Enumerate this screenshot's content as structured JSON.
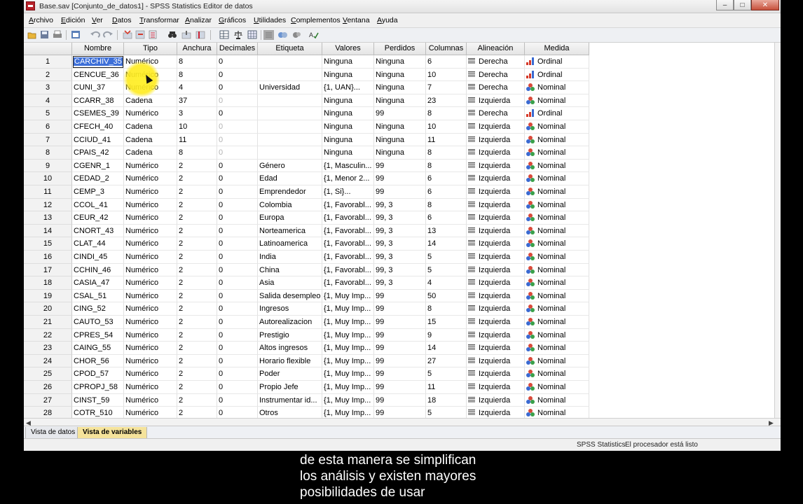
{
  "window": {
    "title": "Base.sav [Conjunto_de_datos1] - SPSS Statistics Editor de datos",
    "minimize": "–",
    "maximize": "□",
    "close": "✕"
  },
  "menu": [
    "Archivo",
    "Edición",
    "Ver",
    "Datos",
    "Transformar",
    "Analizar",
    "Gráficos",
    "Utilidades",
    "Complementos",
    "Ventana",
    "Ayuda"
  ],
  "toolbar_icons": [
    "open-icon",
    "save-icon",
    "print-icon",
    "dialog-recall-icon",
    "undo-icon",
    "redo-icon",
    "goto-case-icon",
    "goto-variable-icon",
    "variables-icon",
    "find-icon",
    "insert-cases-icon",
    "insert-variable-icon",
    "split-file-icon",
    "weight-cases-icon",
    "select-cases-icon",
    "value-labels-icon",
    "use-sets-icon",
    "show-all-icon",
    "spell-icon"
  ],
  "columns": [
    "Nombre",
    "Tipo",
    "Anchura",
    "Decimales",
    "Etiqueta",
    "Valores",
    "Perdidos",
    "Columnas",
    "Alineación",
    "Medida"
  ],
  "rows": [
    {
      "n": "1",
      "nombre": "CARCHIV_35",
      "tipo": "Numérico",
      "anchura": "8",
      "dec": "0",
      "dec_gray": false,
      "etiqueta": "",
      "valores": "Ninguna",
      "perdidos": "Ninguna",
      "columnas": "6",
      "alineacion": "Derecha",
      "medida": "Ordinal"
    },
    {
      "n": "2",
      "nombre": "CENCUE_36",
      "tipo": "Numérico",
      "anchura": "8",
      "dec": "0",
      "dec_gray": false,
      "etiqueta": "",
      "valores": "Ninguna",
      "perdidos": "Ninguna",
      "columnas": "10",
      "alineacion": "Derecha",
      "medida": "Ordinal"
    },
    {
      "n": "3",
      "nombre": "CUNI_37",
      "tipo": "Numérico",
      "anchura": "4",
      "dec": "0",
      "dec_gray": false,
      "etiqueta": "Universidad",
      "valores": "{1, UAN}...",
      "perdidos": "Ninguna",
      "columnas": "7",
      "alineacion": "Derecha",
      "medida": "Nominal"
    },
    {
      "n": "4",
      "nombre": "CCARR_38",
      "tipo": "Cadena",
      "anchura": "37",
      "dec": "0",
      "dec_gray": true,
      "etiqueta": "",
      "valores": "Ninguna",
      "perdidos": "Ninguna",
      "columnas": "23",
      "alineacion": "Izquierda",
      "medida": "Nominal"
    },
    {
      "n": "5",
      "nombre": "CSEMES_39",
      "tipo": "Numérico",
      "anchura": "3",
      "dec": "0",
      "dec_gray": false,
      "etiqueta": "",
      "valores": "Ninguna",
      "perdidos": "99",
      "columnas": "8",
      "alineacion": "Derecha",
      "medida": "Ordinal"
    },
    {
      "n": "6",
      "nombre": "CFECH_40",
      "tipo": "Cadena",
      "anchura": "10",
      "dec": "0",
      "dec_gray": true,
      "etiqueta": "",
      "valores": "Ninguna",
      "perdidos": "Ninguna",
      "columnas": "10",
      "alineacion": "Izquierda",
      "medida": "Nominal"
    },
    {
      "n": "7",
      "nombre": "CCIUD_41",
      "tipo": "Cadena",
      "anchura": "11",
      "dec": "0",
      "dec_gray": true,
      "etiqueta": "",
      "valores": "Ninguna",
      "perdidos": "Ninguna",
      "columnas": "11",
      "alineacion": "Izquierda",
      "medida": "Nominal"
    },
    {
      "n": "8",
      "nombre": "CPAIS_42",
      "tipo": "Cadena",
      "anchura": "8",
      "dec": "0",
      "dec_gray": true,
      "etiqueta": "",
      "valores": "Ninguna",
      "perdidos": "Ninguna",
      "columnas": "8",
      "alineacion": "Izquierda",
      "medida": "Nominal"
    },
    {
      "n": "9",
      "nombre": "CGENR_1",
      "tipo": "Numérico",
      "anchura": "2",
      "dec": "0",
      "dec_gray": false,
      "etiqueta": "Género",
      "valores": "{1, Masculin...",
      "perdidos": "99",
      "columnas": "8",
      "alineacion": "Izquierda",
      "medida": "Nominal"
    },
    {
      "n": "10",
      "nombre": "CEDAD_2",
      "tipo": "Numérico",
      "anchura": "2",
      "dec": "0",
      "dec_gray": false,
      "etiqueta": "Edad",
      "valores": "{1, Menor 2...",
      "perdidos": "99",
      "columnas": "6",
      "alineacion": "Izquierda",
      "medida": "Nominal"
    },
    {
      "n": "11",
      "nombre": "CEMP_3",
      "tipo": "Numérico",
      "anchura": "2",
      "dec": "0",
      "dec_gray": false,
      "etiqueta": "Emprendedor",
      "valores": "{1, Si}...",
      "perdidos": "99",
      "columnas": "6",
      "alineacion": "Izquierda",
      "medida": "Nominal"
    },
    {
      "n": "12",
      "nombre": "CCOL_41",
      "tipo": "Numérico",
      "anchura": "2",
      "dec": "0",
      "dec_gray": false,
      "etiqueta": "Colombia",
      "valores": "{1, Favorabl...",
      "perdidos": "99, 3",
      "columnas": "8",
      "alineacion": "Izquierda",
      "medida": "Nominal"
    },
    {
      "n": "13",
      "nombre": "CEUR_42",
      "tipo": "Numérico",
      "anchura": "2",
      "dec": "0",
      "dec_gray": false,
      "etiqueta": "Europa",
      "valores": "{1, Favorabl...",
      "perdidos": "99, 3",
      "columnas": "6",
      "alineacion": "Izquierda",
      "medida": "Nominal"
    },
    {
      "n": "14",
      "nombre": "CNORT_43",
      "tipo": "Numérico",
      "anchura": "2",
      "dec": "0",
      "dec_gray": false,
      "etiqueta": "Norteamerica",
      "valores": "{1, Favorabl...",
      "perdidos": "99, 3",
      "columnas": "13",
      "alineacion": "Izquierda",
      "medida": "Nominal"
    },
    {
      "n": "15",
      "nombre": "CLAT_44",
      "tipo": "Numérico",
      "anchura": "2",
      "dec": "0",
      "dec_gray": false,
      "etiqueta": "Latinoamerica",
      "valores": "{1, Favorabl...",
      "perdidos": "99, 3",
      "columnas": "14",
      "alineacion": "Izquierda",
      "medida": "Nominal"
    },
    {
      "n": "16",
      "nombre": "CINDI_45",
      "tipo": "Numérico",
      "anchura": "2",
      "dec": "0",
      "dec_gray": false,
      "etiqueta": "India",
      "valores": "{1, Favorabl...",
      "perdidos": "99, 3",
      "columnas": "5",
      "alineacion": "Izquierda",
      "medida": "Nominal"
    },
    {
      "n": "17",
      "nombre": "CCHIN_46",
      "tipo": "Numérico",
      "anchura": "2",
      "dec": "0",
      "dec_gray": false,
      "etiqueta": "China",
      "valores": "{1, Favorabl...",
      "perdidos": "99, 3",
      "columnas": "5",
      "alineacion": "Izquierda",
      "medida": "Nominal"
    },
    {
      "n": "18",
      "nombre": "CASIA_47",
      "tipo": "Numérico",
      "anchura": "2",
      "dec": "0",
      "dec_gray": false,
      "etiqueta": "Asia",
      "valores": "{1, Favorabl...",
      "perdidos": "99, 3",
      "columnas": "4",
      "alineacion": "Izquierda",
      "medida": "Nominal"
    },
    {
      "n": "19",
      "nombre": "CSAL_51",
      "tipo": "Numérico",
      "anchura": "2",
      "dec": "0",
      "dec_gray": false,
      "etiqueta": "Salida desempleo",
      "valores": "{1, Muy Imp...",
      "perdidos": "99",
      "columnas": "50",
      "alineacion": "Izquierda",
      "medida": "Nominal"
    },
    {
      "n": "20",
      "nombre": "CING_52",
      "tipo": "Numérico",
      "anchura": "2",
      "dec": "0",
      "dec_gray": false,
      "etiqueta": "Ingresos",
      "valores": "{1, Muy Imp...",
      "perdidos": "99",
      "columnas": "8",
      "alineacion": "Izquierda",
      "medida": "Nominal"
    },
    {
      "n": "21",
      "nombre": "CAUTO_53",
      "tipo": "Numérico",
      "anchura": "2",
      "dec": "0",
      "dec_gray": false,
      "etiqueta": "Autorealizacion",
      "valores": "{1, Muy Imp...",
      "perdidos": "99",
      "columnas": "15",
      "alineacion": "Izquierda",
      "medida": "Nominal"
    },
    {
      "n": "22",
      "nombre": "CPRES_54",
      "tipo": "Numérico",
      "anchura": "2",
      "dec": "0",
      "dec_gray": false,
      "etiqueta": "Prestigio",
      "valores": "{1, Muy Imp...",
      "perdidos": "99",
      "columnas": "9",
      "alineacion": "Izquierda",
      "medida": "Nominal"
    },
    {
      "n": "23",
      "nombre": "CAING_55",
      "tipo": "Numérico",
      "anchura": "2",
      "dec": "0",
      "dec_gray": false,
      "etiqueta": "Altos ingresos",
      "valores": "{1, Muy Imp...",
      "perdidos": "99",
      "columnas": "14",
      "alineacion": "Izquierda",
      "medida": "Nominal"
    },
    {
      "n": "24",
      "nombre": "CHOR_56",
      "tipo": "Numérico",
      "anchura": "2",
      "dec": "0",
      "dec_gray": false,
      "etiqueta": "Horario flexible",
      "valores": "{1, Muy Imp...",
      "perdidos": "99",
      "columnas": "27",
      "alineacion": "Izquierda",
      "medida": "Nominal"
    },
    {
      "n": "25",
      "nombre": "CPOD_57",
      "tipo": "Numérico",
      "anchura": "2",
      "dec": "0",
      "dec_gray": false,
      "etiqueta": "Poder",
      "valores": "{1, Muy Imp...",
      "perdidos": "99",
      "columnas": "5",
      "alineacion": "Izquierda",
      "medida": "Nominal"
    },
    {
      "n": "26",
      "nombre": "CPROPJ_58",
      "tipo": "Numérico",
      "anchura": "2",
      "dec": "0",
      "dec_gray": false,
      "etiqueta": "Propio Jefe",
      "valores": "{1, Muy Imp...",
      "perdidos": "99",
      "columnas": "11",
      "alineacion": "Izquierda",
      "medida": "Nominal"
    },
    {
      "n": "27",
      "nombre": "CINST_59",
      "tipo": "Numérico",
      "anchura": "2",
      "dec": "0",
      "dec_gray": false,
      "etiqueta": "Instrumentar id...",
      "valores": "{1, Muy Imp...",
      "perdidos": "99",
      "columnas": "18",
      "alineacion": "Izquierda",
      "medida": "Nominal"
    },
    {
      "n": "28",
      "nombre": "COTR_510",
      "tipo": "Numérico",
      "anchura": "2",
      "dec": "0",
      "dec_gray": false,
      "etiqueta": "Otros",
      "valores": "{1, Muy Imp...",
      "perdidos": "99",
      "columnas": "5",
      "alineacion": "Izquierda",
      "medida": "Nominal"
    }
  ],
  "selected_cell": "CARCHIV_35",
  "tabs": {
    "data_view": "Vista de datos",
    "variable_view": "Vista de variables"
  },
  "status": {
    "app": "SPSS Statistics",
    "message": "El procesador está listo"
  },
  "caption": [
    "de esta manera se simplifican",
    "los análisis y existen mayores",
    "posibilidades de usar"
  ],
  "colors": {
    "active_tab": "#f5e39b",
    "selection": "#3d6fd8",
    "ordinal_bar": "#d63a2a",
    "cursor_highlight": "#ffee22"
  }
}
